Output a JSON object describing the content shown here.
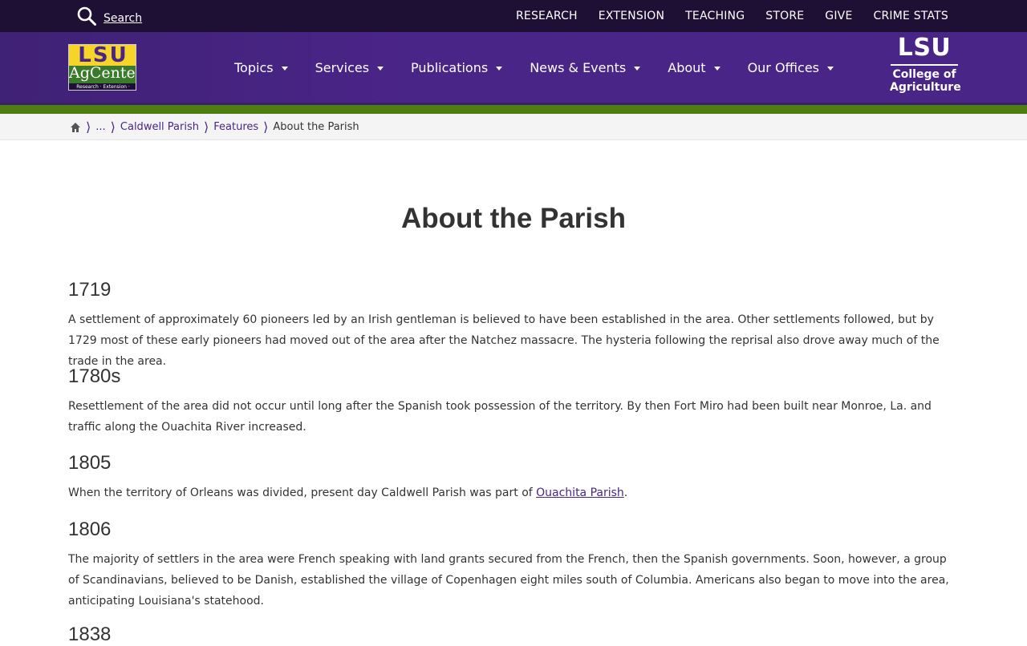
{
  "topbar": {
    "search_label": "Search",
    "links": [
      "RESEARCH",
      "EXTENSION",
      "TEACHING",
      "STORE",
      "GIVE",
      "CRIME STATS"
    ]
  },
  "logo": {
    "lsu": "LSU",
    "name": "AgCenter",
    "tagline": "Research · Extension · Teaching"
  },
  "nav": [
    "Topics",
    "Services",
    "Publications",
    "News & Events",
    "About",
    "Our Offices"
  ],
  "college": {
    "mark": "LSU",
    "line1": "College of",
    "line2": "Agriculture"
  },
  "breadcrumb": {
    "ellipsis": "...",
    "items": [
      "Caldwell Parish",
      "Features"
    ],
    "current": "About the Parish"
  },
  "page": {
    "title": "About the Parish",
    "sections": [
      {
        "year": "1719",
        "text": "A settlement of approximately 60 pioneers led by an Irish gentleman is believed to have been established in the area. Other settlements followed, but by 1729 most of these early pioneers had moved out of the area after the Natchez massacre. The hysteria following the reprisal also drove away much of the trade in the area."
      },
      {
        "year": "1780s",
        "text": "Resettlement of the area did not occur until long after the Spanish took possession of the territory. By then Fort Miro had been built near Monroe, La. and traffic along the Ouachita River increased."
      },
      {
        "year": "1805",
        "text_before": "When the territory of Orleans was divided, present day Caldwell Parish was part of ",
        "link": "Ouachita Parish",
        "text_after": "."
      },
      {
        "year": "1806",
        "text": "The majority of settlers in the area were French speaking with land grants secured from the French, then the Spanish governments. Soon, however, a group of Scandinavians, believed to be Danish, established the village of Copenhagen eight miles south of Columbia. Americans also began to move into the area, anticipating Louisiana's statehood."
      },
      {
        "year": "1838"
      }
    ]
  },
  "colors": {
    "topbar": "#1e1035",
    "header": "#4a2588",
    "green_bar": "#4f7d12",
    "gold": "#f6d42a",
    "link": "#4a2588"
  }
}
